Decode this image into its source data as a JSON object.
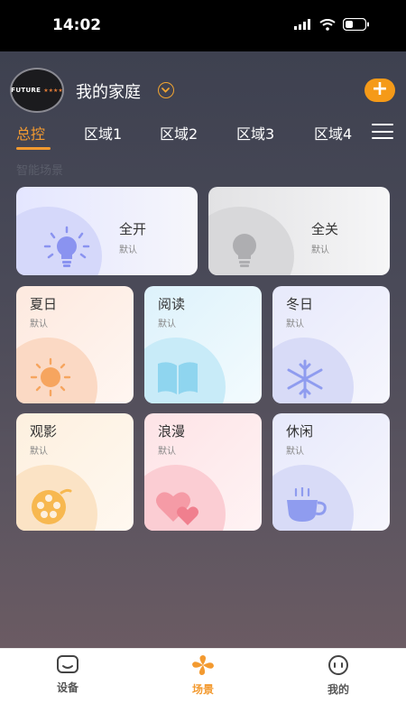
{
  "status_bar": {
    "time": "14:02"
  },
  "header": {
    "avatar_text": "FUTURE",
    "avatar_stars": "★★★★",
    "home_title": "我的家庭",
    "add_label": "+"
  },
  "tabs": [
    {
      "label": "总控",
      "active": true
    },
    {
      "label": "区域1"
    },
    {
      "label": "区域2"
    },
    {
      "label": "区域3"
    },
    {
      "label": "区域4"
    }
  ],
  "section_label": "智能场景",
  "scenes": [
    {
      "name": "全开",
      "sub": "默认",
      "icon": "bulb-on-icon"
    },
    {
      "name": "全关",
      "sub": "默认",
      "icon": "bulb-off-icon"
    },
    {
      "name": "夏日",
      "sub": "默认",
      "icon": "sun-icon"
    },
    {
      "name": "阅读",
      "sub": "默认",
      "icon": "book-icon"
    },
    {
      "name": "冬日",
      "sub": "默认",
      "icon": "snowflake-icon"
    },
    {
      "name": "观影",
      "sub": "默认",
      "icon": "film-reel-icon"
    },
    {
      "name": "浪漫",
      "sub": "默认",
      "icon": "hearts-icon"
    },
    {
      "name": "休闲",
      "sub": "默认",
      "icon": "coffee-cup-icon"
    }
  ],
  "bottom_nav": [
    {
      "label": "设备",
      "icon": "device-icon"
    },
    {
      "label": "场景",
      "icon": "scene-icon",
      "active": true
    },
    {
      "label": "我的",
      "icon": "profile-icon"
    }
  ],
  "colors": {
    "accent": "#f39a30"
  }
}
